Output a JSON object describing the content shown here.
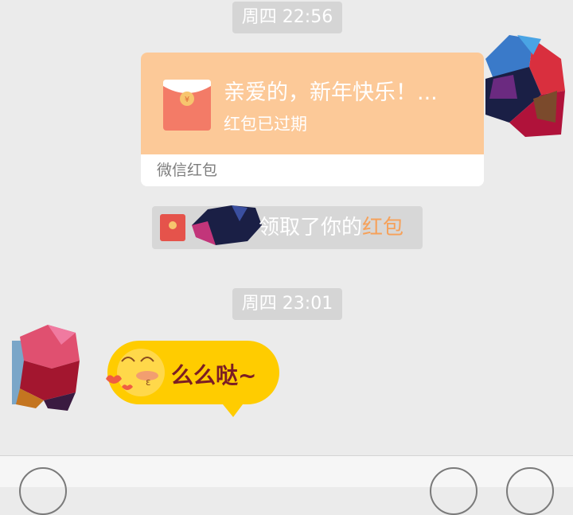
{
  "timestamps": [
    "周四 22:56",
    "周四 23:01"
  ],
  "red_packet": {
    "title": "亲爱的，新年快乐！...",
    "status": "红包已过期",
    "footer": "微信红包",
    "colors": {
      "top": "#fcc998",
      "envelope": "#f37b67"
    }
  },
  "notice": {
    "text": "领取了你的",
    "link": "红包",
    "link_color": "#f6a15a"
  },
  "sticker": {
    "text": "么么哒~",
    "bubble_color": "#ffcc00"
  },
  "input_bar": {
    "left_button_icon": "voice-icon",
    "emoji_button_icon": "emoji-icon",
    "more_button_icon": "plus-icon"
  }
}
